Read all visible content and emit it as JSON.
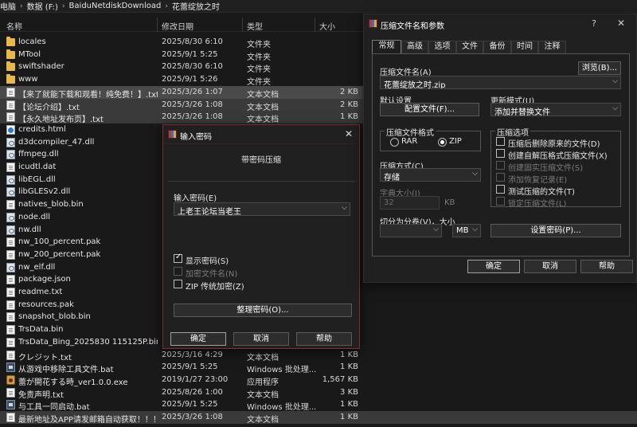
{
  "explorer": {
    "breadcrumb": [
      "电脑",
      "数据 (F:)",
      "BaiduNetdiskDownload",
      "花蕾绽放之时"
    ],
    "columns": {
      "name": "名称",
      "date": "修改日期",
      "type": "类型",
      "size": "大小"
    },
    "files": [
      {
        "name": "locales",
        "date": "2025/8/30 6:10",
        "type": "文件夹",
        "size": "",
        "icon": "folder-icon"
      },
      {
        "name": "MTool",
        "date": "2025/9/1 5:25",
        "type": "文件夹",
        "size": "",
        "icon": "folder-icon"
      },
      {
        "name": "swiftshader",
        "date": "2025/8/30 6:10",
        "type": "文件夹",
        "size": "",
        "icon": "folder-icon"
      },
      {
        "name": "www",
        "date": "2025/9/1 5:26",
        "type": "文件夹",
        "size": "",
        "icon": "folder-icon"
      },
      {
        "name": "【来了就能下载和观看！纯免费！】.txt",
        "date": "2025/3/26 1:07",
        "type": "文本文档",
        "size": "2 KB",
        "icon": "text-file-icon"
      },
      {
        "name": "【论坛介绍】.txt",
        "date": "2025/3/26 1:08",
        "type": "文本文档",
        "size": "2 KB",
        "icon": "text-file-icon"
      },
      {
        "name": "【永久地址发布页】.txt",
        "date": "2025/3/26 1:08",
        "type": "文本文档",
        "size": "1 KB",
        "icon": "text-file-icon"
      },
      {
        "name": "credits.html",
        "date": "",
        "type": "",
        "size": "",
        "icon": "html-file-icon"
      },
      {
        "name": "d3dcompiler_47.dll",
        "date": "",
        "type": "",
        "size": "",
        "icon": "dll-file-icon"
      },
      {
        "name": "ffmpeg.dll",
        "date": "",
        "type": "",
        "size": "",
        "icon": "dll-file-icon"
      },
      {
        "name": "icudtl.dat",
        "date": "",
        "type": "",
        "size": "",
        "icon": "text-file-icon"
      },
      {
        "name": "libEGL.dll",
        "date": "",
        "type": "",
        "size": "",
        "icon": "dll-file-icon"
      },
      {
        "name": "libGLESv2.dll",
        "date": "",
        "type": "",
        "size": "",
        "icon": "dll-file-icon"
      },
      {
        "name": "natives_blob.bin",
        "date": "",
        "type": "",
        "size": "",
        "icon": "text-file-icon"
      },
      {
        "name": "node.dll",
        "date": "",
        "type": "",
        "size": "",
        "icon": "dll-file-icon"
      },
      {
        "name": "nw.dll",
        "date": "",
        "type": "",
        "size": "",
        "icon": "dll-file-icon"
      },
      {
        "name": "nw_100_percent.pak",
        "date": "",
        "type": "",
        "size": "",
        "icon": "text-file-icon"
      },
      {
        "name": "nw_200_percent.pak",
        "date": "",
        "type": "",
        "size": "",
        "icon": "text-file-icon"
      },
      {
        "name": "nw_elf.dll",
        "date": "",
        "type": "",
        "size": "",
        "icon": "dll-file-icon"
      },
      {
        "name": "package.json",
        "date": "",
        "type": "",
        "size": "",
        "icon": "text-file-icon"
      },
      {
        "name": "readme.txt",
        "date": "",
        "type": "",
        "size": "",
        "icon": "text-file-icon"
      },
      {
        "name": "resources.pak",
        "date": "",
        "type": "",
        "size": "",
        "icon": "text-file-icon"
      },
      {
        "name": "snapshot_blob.bin",
        "date": "",
        "type": "",
        "size": "",
        "icon": "text-file-icon"
      },
      {
        "name": "TrsData.bin",
        "date": "",
        "type": "",
        "size": "",
        "icon": "text-file-icon"
      },
      {
        "name": "TrsData_Bing_2025830 115125P.bin",
        "date": "",
        "type": "",
        "size": "",
        "icon": "text-file-icon"
      },
      {
        "name": "クレジット.txt",
        "date": "2025/3/16 4:29",
        "type": "文本文档",
        "size": "1 KB",
        "icon": "text-file-icon"
      },
      {
        "name": "从游戏中移除工具文件.bat",
        "date": "2025/9/1 5:25",
        "type": "Windows 批处理...",
        "size": "1 KB",
        "icon": "batch-file-icon"
      },
      {
        "name": "蕾が開花する時_ver1.0.0.exe",
        "date": "2019/1/27 23:00",
        "type": "应用程序",
        "size": "1,567 KB",
        "icon": "game-exe-icon"
      },
      {
        "name": "免责声明.txt",
        "date": "2025/8/26 1:00",
        "type": "文本文档",
        "size": "3 KB",
        "icon": "text-file-icon"
      },
      {
        "name": "与工具一同启动.bat",
        "date": "2025/9/1 5:25",
        "type": "Windows 批处理...",
        "size": "1 KB",
        "icon": "batch-file-icon"
      },
      {
        "name": "最新地址及APP请发邮箱自动获取！！！...",
        "date": "2025/3/26 1:08",
        "type": "文本文档",
        "size": "1 KB",
        "icon": "text-file-icon"
      }
    ]
  },
  "password_dialog": {
    "title": "输入密码",
    "subtitle": "带密码压缩",
    "password_label": "输入密码(E)",
    "password_value": "上老王论坛当老王",
    "show_password_label": "显示密码(S)",
    "show_password_checked": true,
    "encrypt_names_label": "加密文件名(N)",
    "encrypt_names_checked": false,
    "zip_legacy_label": "ZIP 传统加密(Z)",
    "zip_legacy_checked": false,
    "organize_button": "整理密码(O)...",
    "ok_button": "确定",
    "cancel_button": "取消",
    "help_button": "帮助"
  },
  "archive_dialog": {
    "title": "压缩文件名和参数",
    "help_glyph": "?",
    "close_glyph": "✕",
    "tabs": [
      "常规",
      "高级",
      "选项",
      "文件",
      "备份",
      "时间",
      "注释"
    ],
    "active_tab": 0,
    "archive_name_label": "压缩文件名(A)",
    "browse_button": "浏览(B)...",
    "archive_name_value": "花蕾绽放之时.zip",
    "default_settings_label": "默认设置",
    "profiles_button": "配置文件(F)...",
    "update_mode_label": "更新模式(U)",
    "update_mode_value": "添加并替换文件",
    "format_group_label": "压缩文件格式",
    "format_options": [
      "RAR",
      "ZIP"
    ],
    "format_selected": "ZIP",
    "method_label": "压缩方式(C)",
    "method_value": "存储",
    "dictionary_label": "字典大小(I)",
    "dictionary_value": "32",
    "dictionary_unit": "KB",
    "split_label": "切分为分卷(V)，大小",
    "split_value": "",
    "split_unit": "MB",
    "options_group_label": "压缩选项",
    "options": [
      {
        "label": "压缩后删除原来的文件(D)",
        "checked": false,
        "disabled": false
      },
      {
        "label": "创建自解压格式压缩文件(X)",
        "checked": false,
        "disabled": false
      },
      {
        "label": "创建固实压缩文件(S)",
        "checked": false,
        "disabled": true
      },
      {
        "label": "添加恢复记录(E)",
        "checked": false,
        "disabled": true
      },
      {
        "label": "测试压缩的文件(T)",
        "checked": false,
        "disabled": false
      },
      {
        "label": "锁定压缩文件(L)",
        "checked": false,
        "disabled": true
      }
    ],
    "set_password_button": "设置密码(P)...",
    "ok_button": "确定",
    "cancel_button": "取消",
    "help_button": "帮助"
  }
}
